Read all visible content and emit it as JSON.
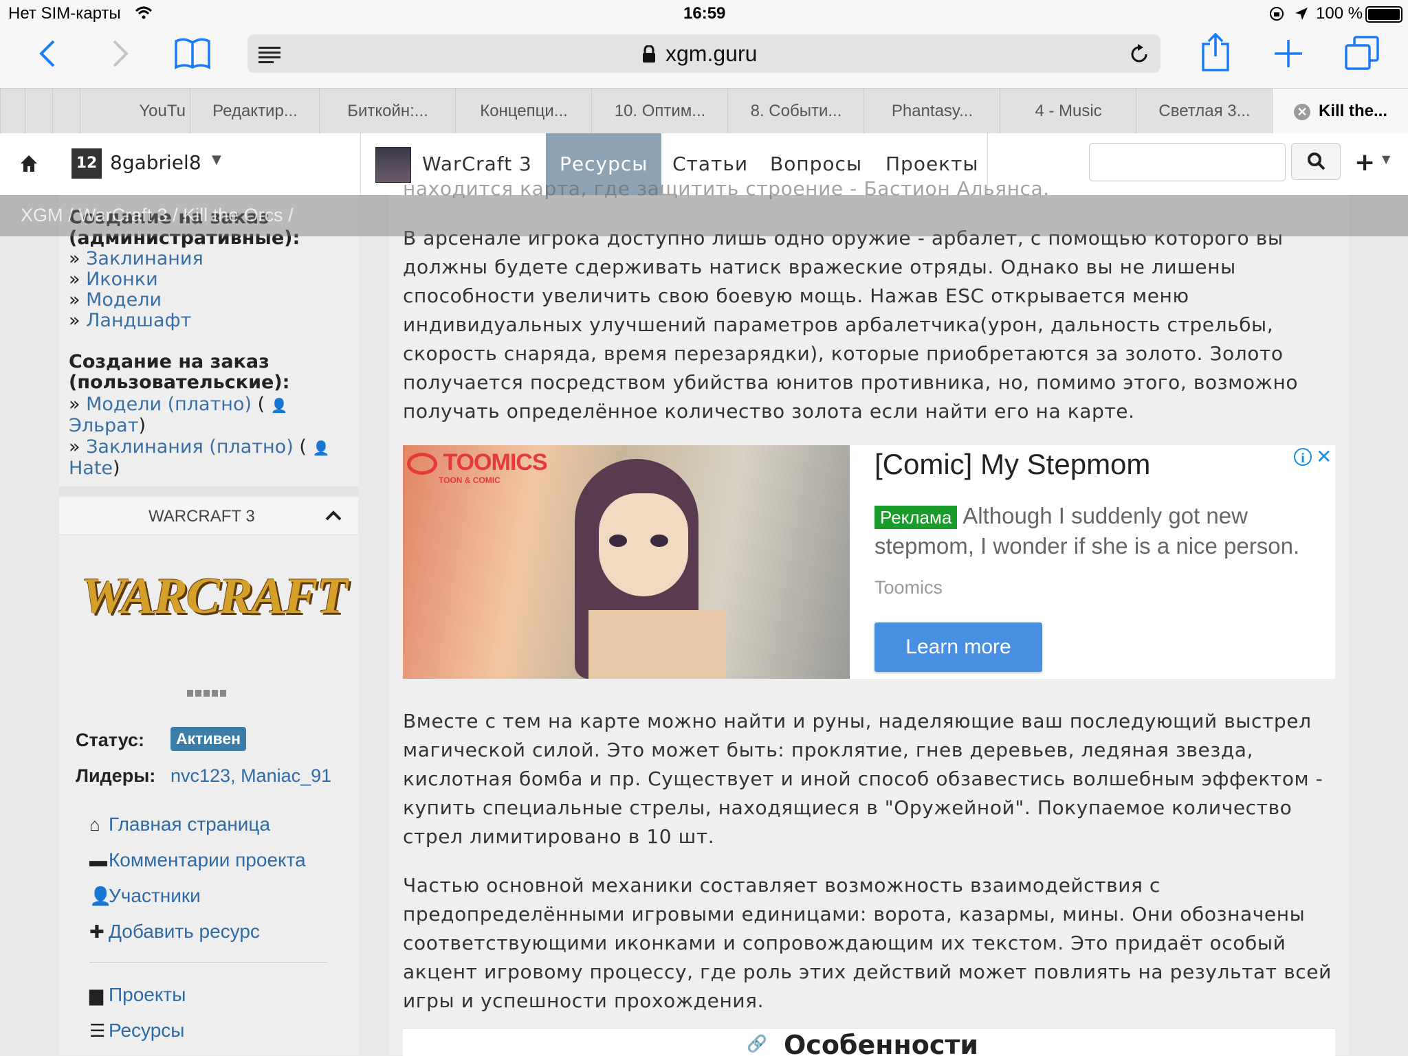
{
  "status_bar": {
    "carrier": "Нет SIM-карты",
    "time": "16:59",
    "battery": "100 %"
  },
  "browser": {
    "url": "xgm.guru",
    "icons": [
      "back-icon",
      "forward-icon",
      "bookmarks-icon",
      "reader-icon",
      "lock-icon",
      "reload-icon",
      "share-icon",
      "new-tab-icon",
      "tabs-icon"
    ]
  },
  "tabs": [
    {
      "label": "YouTu"
    },
    {
      "label": "Редактир..."
    },
    {
      "label": "Биткойн:..."
    },
    {
      "label": "Концепци..."
    },
    {
      "label": "10. Оптим..."
    },
    {
      "label": "8. Событи..."
    },
    {
      "label": "Phantasy..."
    },
    {
      "label": "4 - Music"
    },
    {
      "label": "Светлая 3..."
    },
    {
      "label": "Kill the..."
    }
  ],
  "site_nav": {
    "user_badge": "12",
    "username": "8gabriel8",
    "project": "WarCraft 3",
    "links": [
      "Ресурсы",
      "Статьи",
      "Вопросы",
      "Проекты"
    ],
    "active_link": "Ресурсы",
    "search_placeholder": ""
  },
  "breadcrumb": {
    "items": [
      "XGM",
      "WarCraft 3",
      "Kill the Orcs"
    ],
    "separator": "/"
  },
  "sidebar": {
    "order_admin_title": "Создание на заказ (административные):",
    "order_admin_links": [
      "Заклинания",
      "Иконки",
      "Модели",
      "Ландшафт"
    ],
    "order_user_title": "Создание на заказ (пользовательские):",
    "order_user_items": [
      {
        "link": "Модели (платно)",
        "user": "Эльрат"
      },
      {
        "link": "Заклинания (платно)",
        "user": "Hate"
      }
    ],
    "panel_title": "WARCRAFT 3",
    "logo_text": "WARCRAFT",
    "status_label": "Статус:",
    "status_value": "Активен",
    "leaders_label": "Лидеры:",
    "leaders_value": "nvc123, Maniac_91",
    "menu": [
      "Главная страница",
      "Комментарии проекта",
      "Участники",
      "Добавить ресурс"
    ],
    "menu2": [
      "Проекты",
      "Ресурсы"
    ]
  },
  "content": {
    "partial_top": "находится карта, где защитить строение - Бастион Альянса.",
    "p1": "В арсенале игрока доступно лишь одно оружие - арбалет, с помощью которого вы должны будете сдерживать натиск вражеские отряды. Однако вы не лишены способности увеличить свою боевую мощь. Нажав ESC открывается меню индивидуальных улучшений параметров арбалетчика(урон, дальность стрельбы, скорость снаряда, время перезарядки), которые приобретаются за золото. Золото получается посредством убийства юнитов противника, но, помимо этого, возможно получать определённое количество золота если найти его на карте.",
    "p2": "Вместе с тем на карте можно найти и руны, наделяющие ваш последующий выстрел магической силой. Это может быть: проклятие, гнев деревьев, ледяная звезда, кислотная бомба и пр. Существует и иной способ обзавестись волшебным эффектом - купить специальные стрелы, находящиеся в \"Оружейной\". Покупаемое количество стрел лимитировано в 10 шт.",
    "p3": "Частью основной механики составляет возможность взаимодействия с предопределёнными игровыми единицами: ворота, казармы, мины. Они обозначены соответствующими иконками и сопровождающим их текстом. Это придаёт особый акцент игровому процессу, где роль этих действий может повлиять на результат всей игры и успешности прохождения.",
    "section_heading": "Особенности"
  },
  "ad": {
    "brand_logo": "TOOMICS",
    "brand_sub": "TOON & COMIC",
    "title": "[Comic] My Stepmom",
    "badge": "Реклама",
    "text": "Although I suddenly got new stepmom, I wonder if she is a nice person.",
    "advertiser": "Toomics",
    "cta": "Learn more",
    "accent": "#4a90e2",
    "badge_color": "#1a9c2b"
  }
}
